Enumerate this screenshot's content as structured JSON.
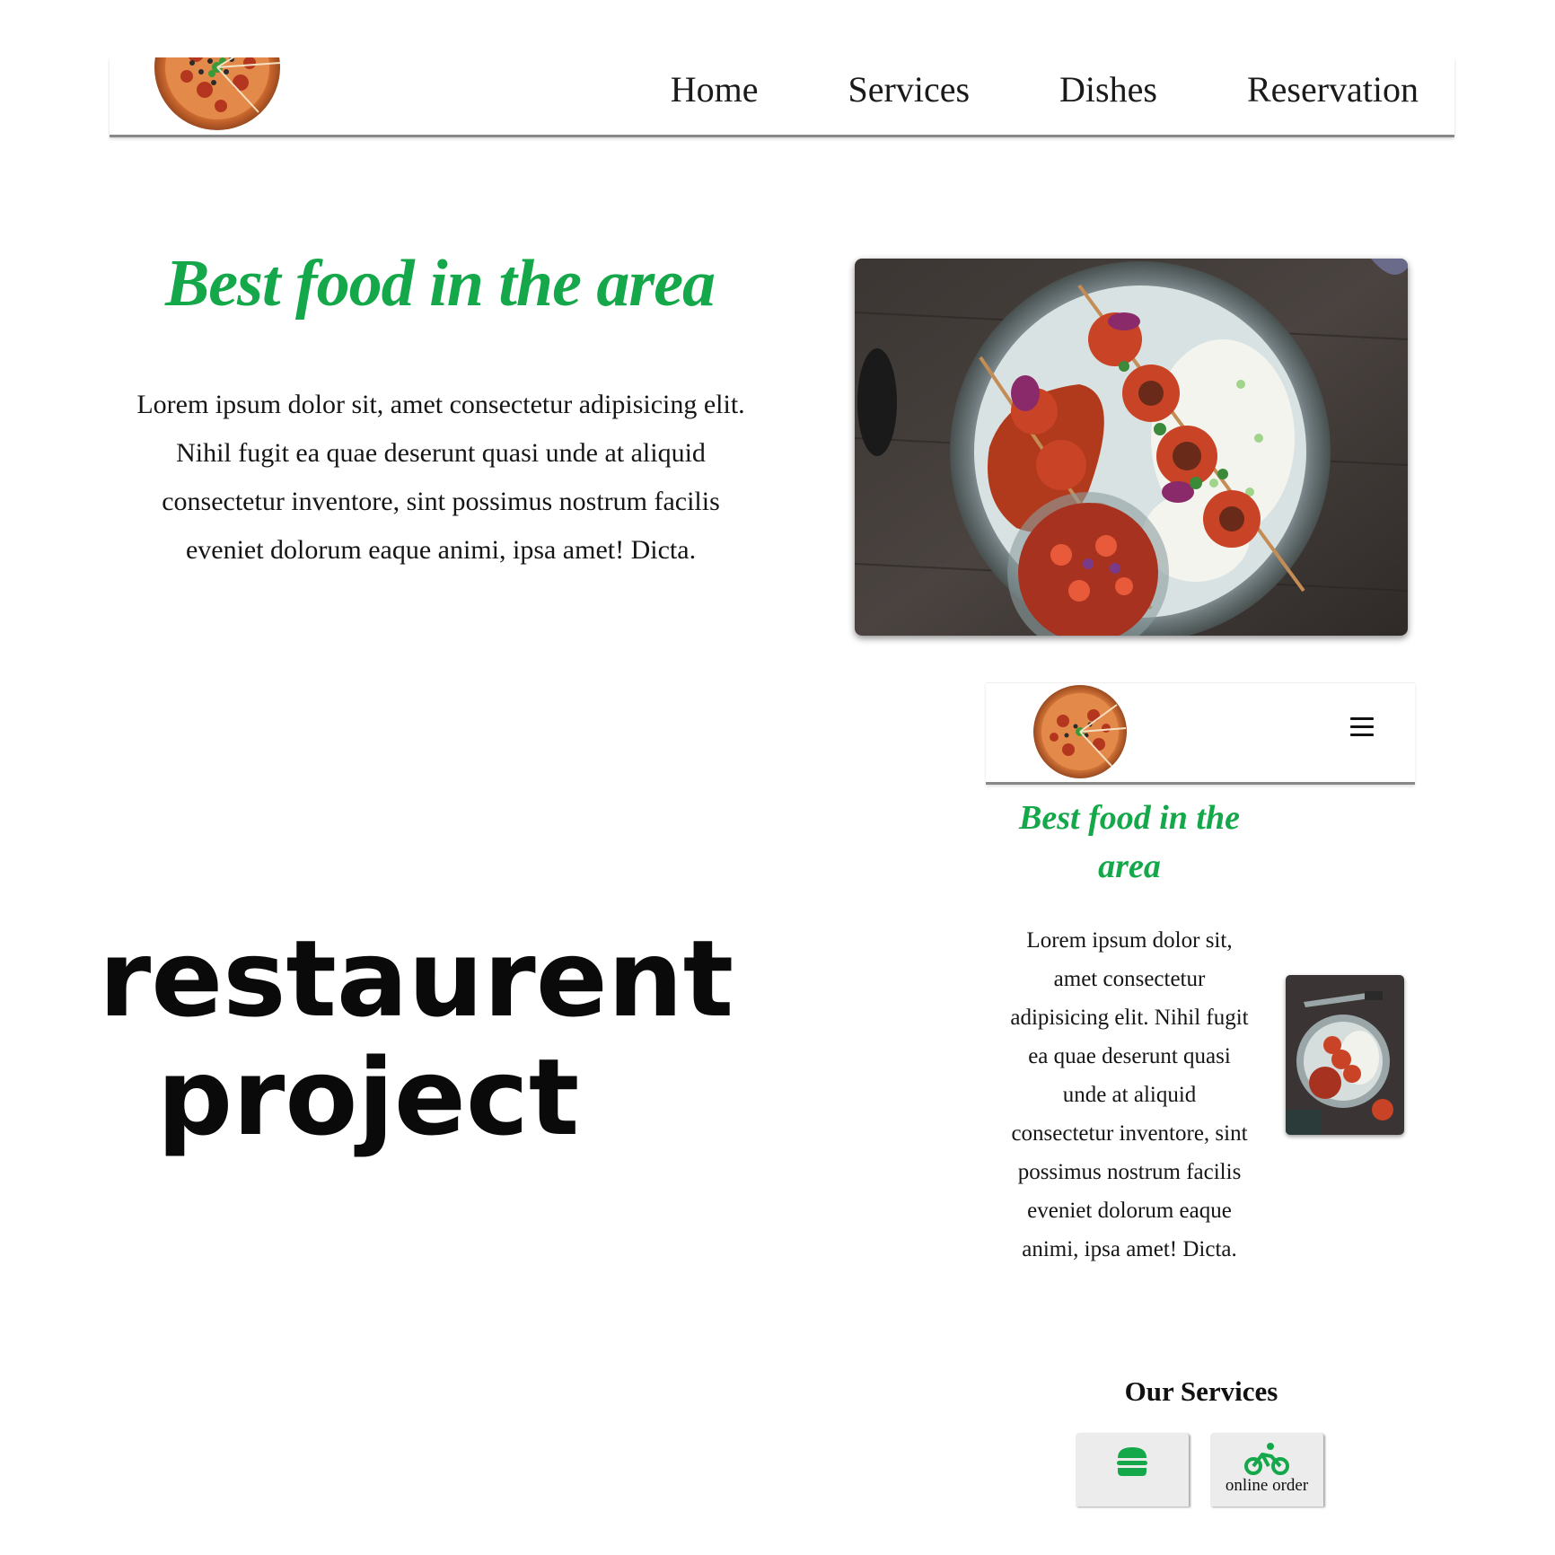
{
  "desktop": {
    "logo_alt": "pizza-logo",
    "nav": [
      {
        "label": "Home"
      },
      {
        "label": "Services"
      },
      {
        "label": "Dishes"
      },
      {
        "label": "Reservation"
      }
    ],
    "hero": {
      "title": "Best food in the area",
      "text": "Lorem ipsum dolor sit, amet consectetur adipisicing elit. Nihil fugit ea quae deserunt quasi unde at aliquid consectetur inventore, sint possimus nostrum facilis eveniet dolorum eaque animi, ipsa amet! Dicta."
    }
  },
  "caption": {
    "line1": "restaurent",
    "line2": "project"
  },
  "mobile": {
    "menu_icon": "hamburger-icon",
    "hero": {
      "title": "Best food in the area",
      "text": "Lorem ipsum dolor sit, amet consectetur adipisicing elit. Nihil fugit ea quae deserunt quasi unde at aliquid consectetur inventore, sint possimus nostrum facilis eveniet dolorum eaque animi, ipsa amet! Dicta."
    },
    "services": {
      "title": "Our Services",
      "cards": [
        {
          "icon": "burger-icon",
          "label": ""
        },
        {
          "icon": "bicycle-icon",
          "label": "online order"
        }
      ]
    }
  },
  "colors": {
    "accent": "#14a84a",
    "text": "#151515",
    "header_border": "#888888",
    "card_bg": "#ececec"
  }
}
